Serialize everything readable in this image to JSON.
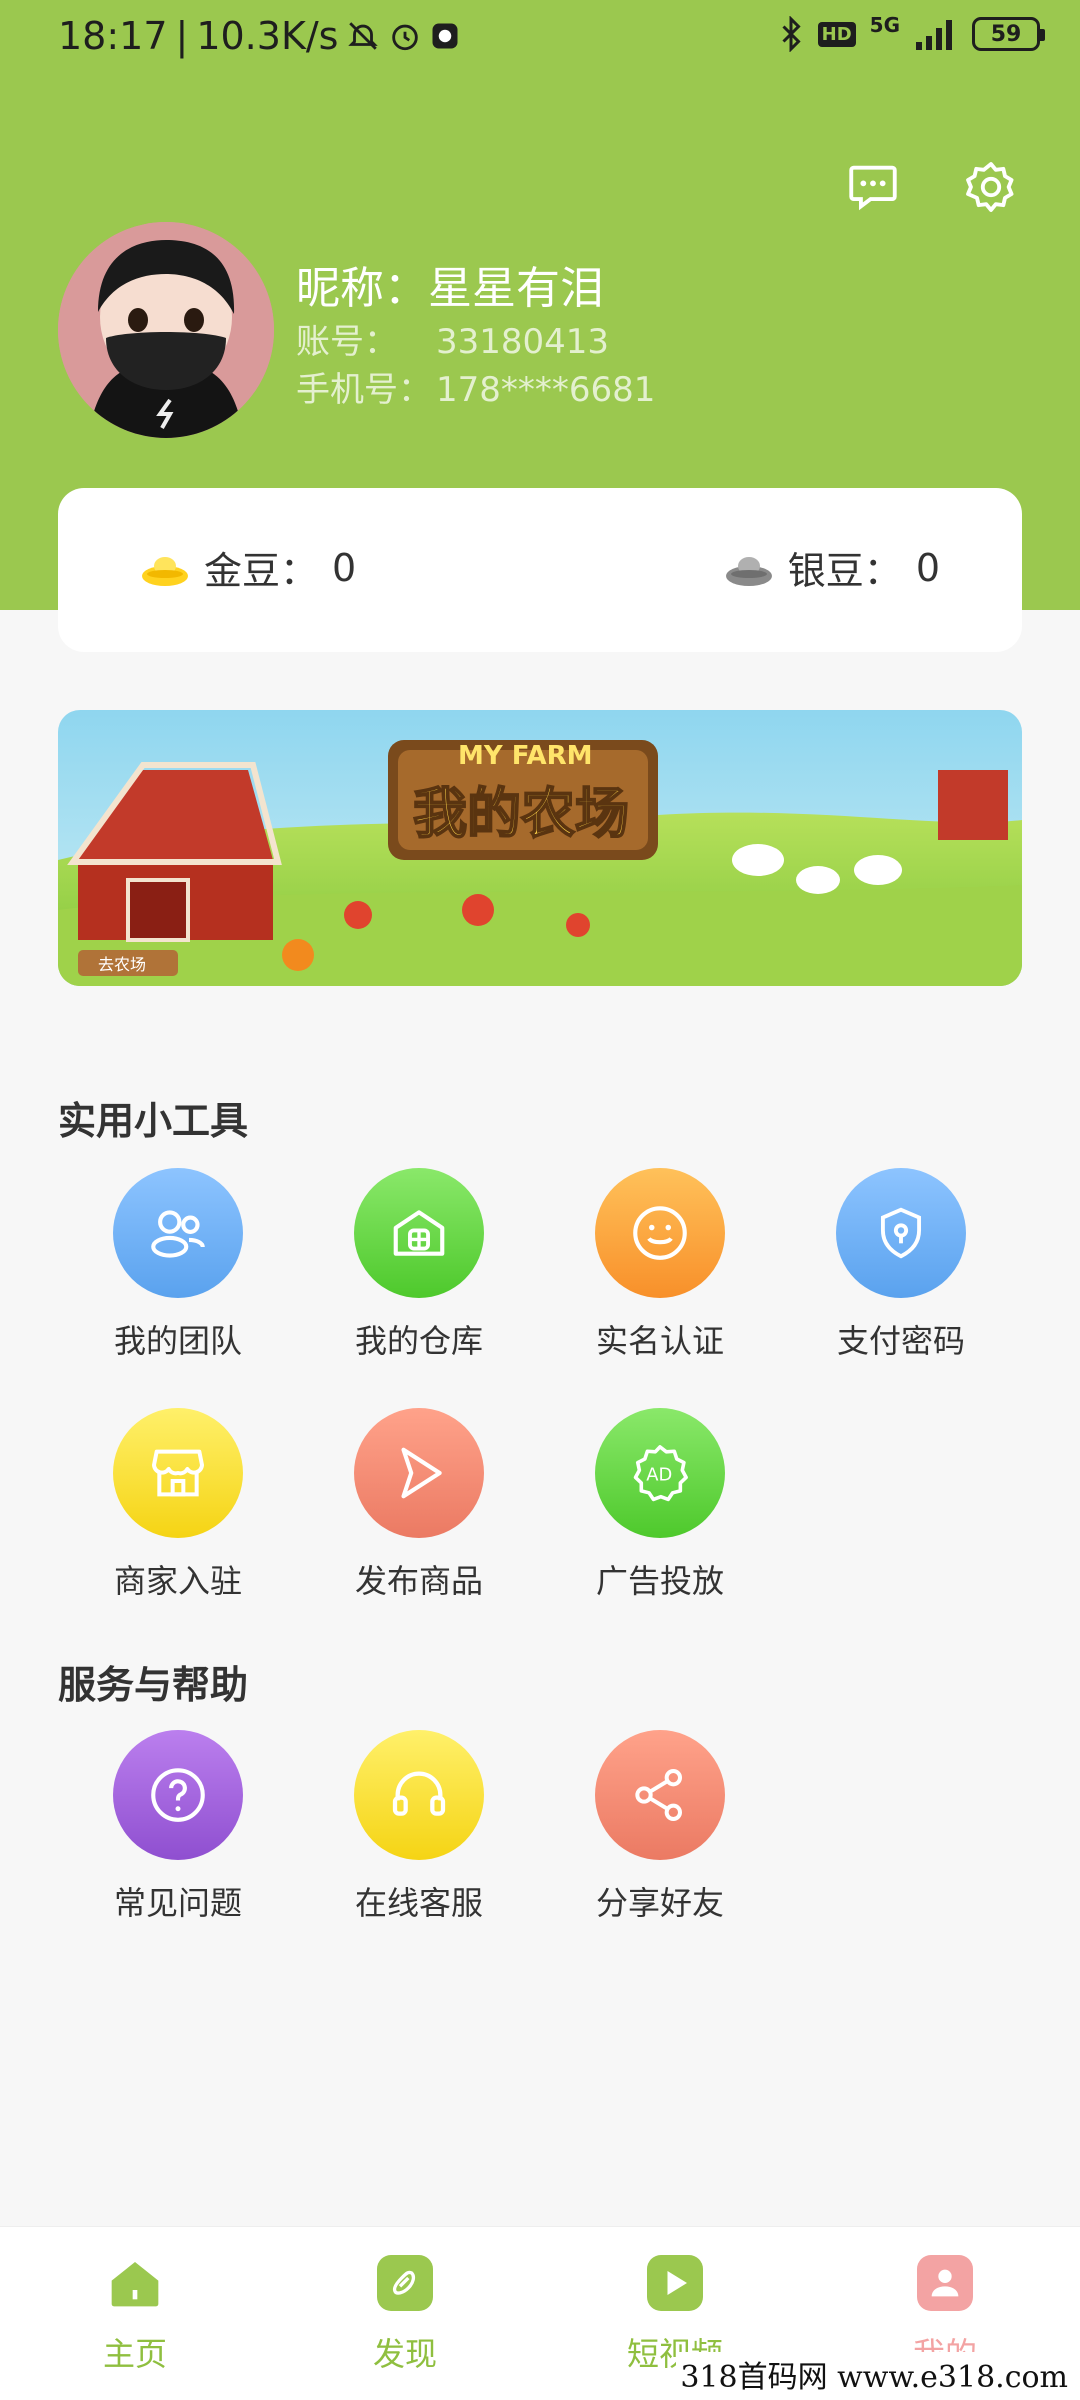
{
  "status_bar": {
    "time": "18:17",
    "speed": "10.3K/s",
    "network": "5G",
    "hd": "HD",
    "battery": "59"
  },
  "profile": {
    "nickname_label": "昵称：",
    "nickname": "星星有泪",
    "account_label": "账号：",
    "account": "33180413",
    "phone_label": "手机号：",
    "phone": "178****6681"
  },
  "beans": {
    "gold_label": "金豆：",
    "gold_value": "0",
    "silver_label": "银豆：",
    "silver_value": "0"
  },
  "banner": {
    "brand": "MY FARM",
    "title": "我的农场",
    "sign": "去农场"
  },
  "sections": {
    "tools_title": "实用小工具",
    "help_title": "服务与帮助"
  },
  "tools": [
    {
      "label": "我的团队",
      "icon": "team-icon",
      "color": "#6fb0f5"
    },
    {
      "label": "我的仓库",
      "icon": "warehouse-icon",
      "color": "#6ad34a"
    },
    {
      "label": "实名认证",
      "icon": "smile-icon",
      "color": "#fba33c"
    },
    {
      "label": "支付密码",
      "icon": "shield-lock-icon",
      "color": "#6fb0f5"
    },
    {
      "label": "商家入驻",
      "icon": "shop-icon",
      "color": "#f5dd28"
    },
    {
      "label": "发布商品",
      "icon": "send-icon",
      "color": "#f08a74"
    },
    {
      "label": "广告投放",
      "icon": "ad-icon",
      "color": "#6ad34a"
    }
  ],
  "help": [
    {
      "label": "常见问题",
      "icon": "question-icon",
      "color": "#a160d8"
    },
    {
      "label": "在线客服",
      "icon": "headset-icon",
      "color": "#f5dd28"
    },
    {
      "label": "分享好友",
      "icon": "share-icon",
      "color": "#f08a74"
    }
  ],
  "nav": [
    {
      "label": "主页",
      "icon": "home-icon",
      "active": false
    },
    {
      "label": "发现",
      "icon": "discover-icon",
      "active": false
    },
    {
      "label": "短视频",
      "icon": "video-icon",
      "active": false
    },
    {
      "label": "我的",
      "icon": "profile-icon",
      "active": true
    }
  ],
  "colors": {
    "brand_green": "#9bc84f",
    "nav_active": "#f3a3a3",
    "nav_inactive": "#8fbf3f"
  },
  "watermark": "318首码网 www.e318.com"
}
